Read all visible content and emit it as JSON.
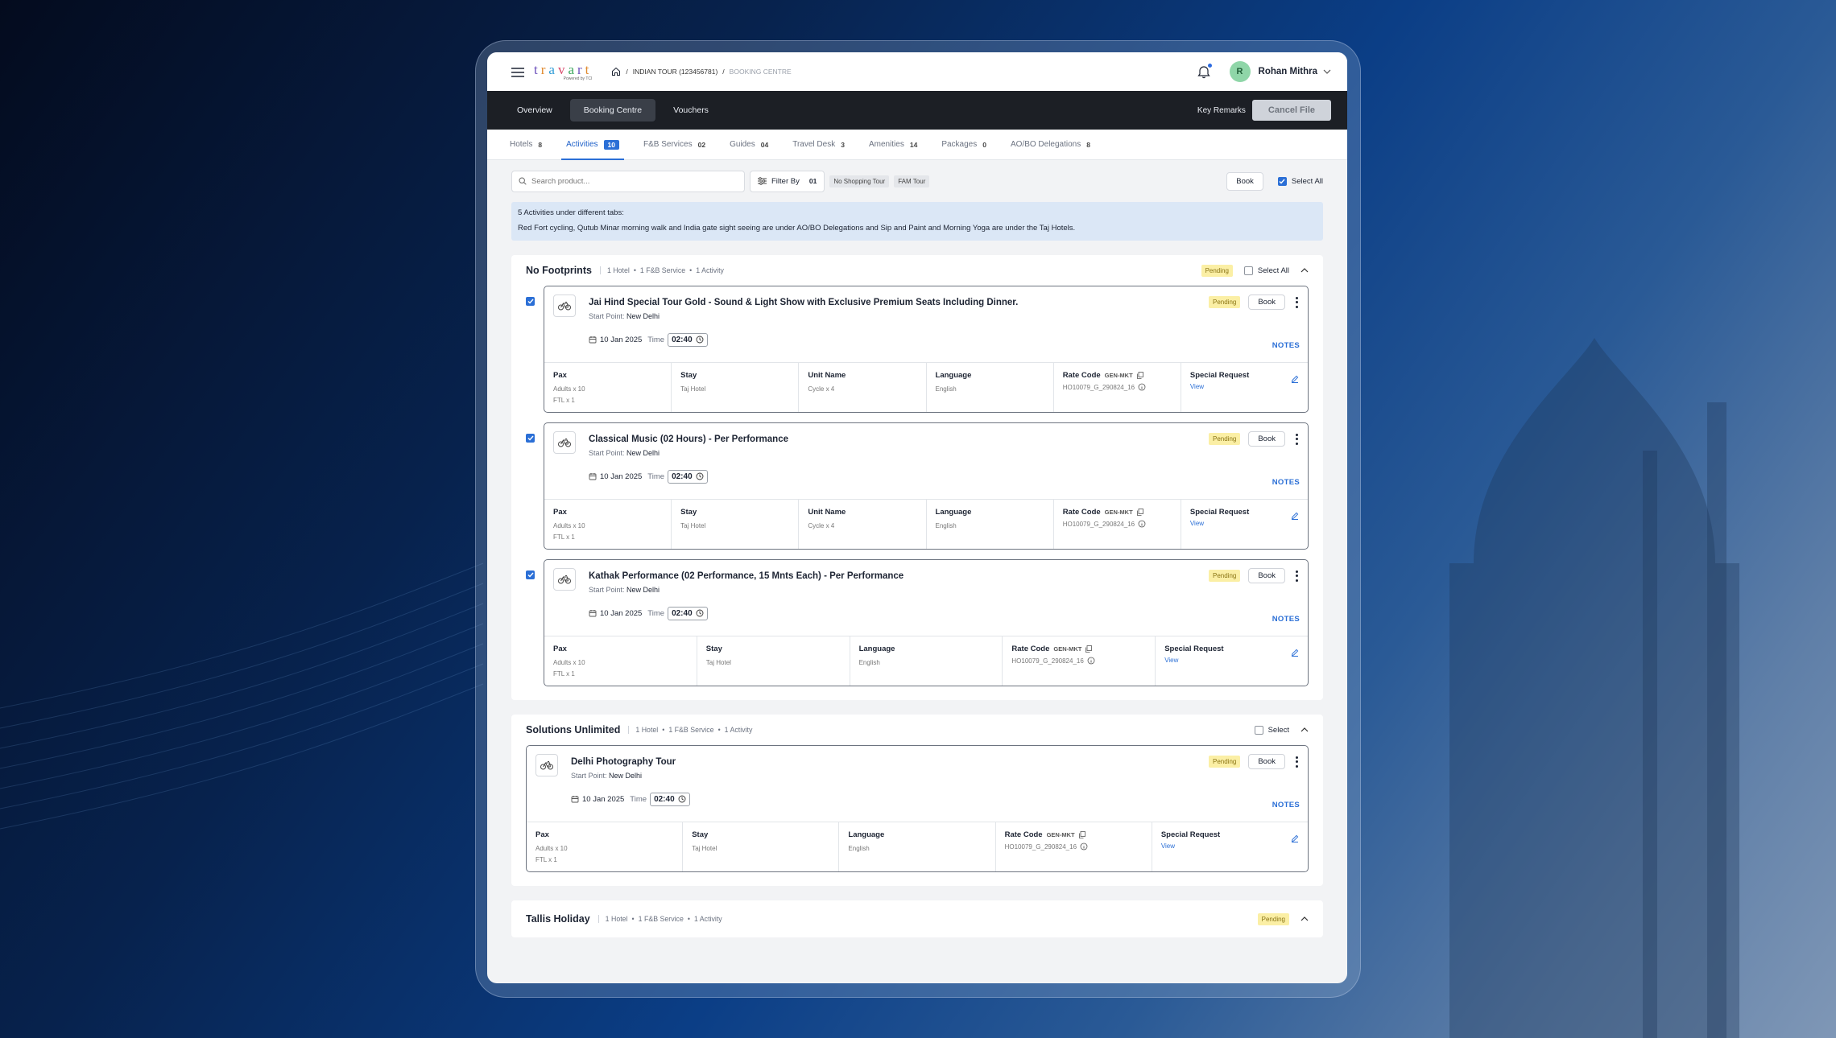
{
  "app": {
    "brand": "travart",
    "powered_by": "Powered by TCI"
  },
  "breadcrumb": {
    "tour": "INDIAN TOUR (123456781)",
    "current": "BOOKING CENTRE"
  },
  "user": {
    "initial": "R",
    "name": "Rohan Mithra"
  },
  "nav": {
    "tabs": [
      "Overview",
      "Booking Centre",
      "Vouchers"
    ],
    "active": "Booking Centre",
    "key_remarks": "Key Remarks",
    "cancel_file": "Cancel File"
  },
  "subtabs": [
    {
      "label": "Hotels",
      "count": "8"
    },
    {
      "label": "Activities",
      "count": "10"
    },
    {
      "label": "F&B Services",
      "count": "02"
    },
    {
      "label": "Guides",
      "count": "04"
    },
    {
      "label": "Travel Desk",
      "count": "3"
    },
    {
      "label": "Amenities",
      "count": "14"
    },
    {
      "label": "Packages",
      "count": "0"
    },
    {
      "label": "AO/BO Delegations",
      "count": "8"
    }
  ],
  "toolbar": {
    "search_placeholder": "Search product...",
    "filter_label": "Filter By",
    "filter_count": "01",
    "chips": [
      "No Shopping Tour",
      "FAM Tour"
    ],
    "book": "Book",
    "select_all": "Select All"
  },
  "info": {
    "title": "5 Activities under different tabs:",
    "body": "Red Fort cycling, Qutub Minar morning walk and India gate sight seeing are under AO/BO Delegations and Sip and Paint and Morning Yoga are under the Taj Hotels."
  },
  "labels": {
    "pending": "Pending",
    "book": "Book",
    "notes": "NOTES",
    "start_point": "Start Point:",
    "time": "Time",
    "pax": "Pax",
    "stay": "Stay",
    "unit_name": "Unit Name",
    "language": "Language",
    "rate_code": "Rate Code",
    "special_request": "Special Request",
    "view": "View"
  },
  "groups": [
    {
      "name": "No Footprints",
      "meta": [
        "1 Hotel",
        "1 F&B Service",
        "1 Activity"
      ],
      "status": "Pending",
      "select_label": "Select All",
      "cards": [
        {
          "title": "Jai Hind Special Tour Gold - Sound & Light Show with Exclusive Premium Seats Including Dinner.",
          "start": "New Delhi",
          "date": "10 Jan 2025",
          "time": "02:40",
          "status": "Pending",
          "pax": [
            "Adults x 10",
            "FTL x 1"
          ],
          "stay": "Taj Hotel",
          "unit": "Cycle x 4",
          "language": "English",
          "rate_tag": "GEN-MKT",
          "rate_code": "HO10079_G_290824_16"
        },
        {
          "title": "Classical Music (02 Hours) - Per Performance",
          "start": "New Delhi",
          "date": "10 Jan 2025",
          "time": "02:40",
          "status": "Pending",
          "pax": [
            "Adults x 10",
            "FTL x 1"
          ],
          "stay": "Taj Hotel",
          "unit": "Cycle x 4",
          "language": "English",
          "rate_tag": "GEN-MKT",
          "rate_code": "HO10079_G_290824_16"
        },
        {
          "title": "Kathak Performance (02 Performance, 15 Mnts Each) - Per Performance",
          "start": "New Delhi",
          "date": "10 Jan 2025",
          "time": "02:40",
          "status": "Pending",
          "pax": [
            "Adults x 10",
            "FTL x 1"
          ],
          "stay": "Taj Hotel",
          "language": "English",
          "rate_tag": "GEN-MKT",
          "rate_code": "HO10079_G_290824_16"
        }
      ]
    },
    {
      "name": "Solutions Unlimited",
      "meta": [
        "1 Hotel",
        "1 F&B Service",
        "1 Activity"
      ],
      "select_label": "Select",
      "cards": [
        {
          "title": "Delhi Photography Tour",
          "start": "New Delhi",
          "date": "10 Jan 2025",
          "time": "02:40",
          "status": "Pending",
          "pax": [
            "Adults x 10",
            "FTL x 1"
          ],
          "stay": "Taj Hotel",
          "language": "English",
          "rate_tag": "GEN-MKT",
          "rate_code": "HO10079_G_290824_16"
        }
      ]
    },
    {
      "name": "Tallis Holiday",
      "meta": [
        "1 Hotel",
        "1 F&B Service",
        "1 Activity"
      ],
      "status": "Pending"
    }
  ],
  "colors": {
    "accent": "#2b6fd6",
    "pending_bg": "#fbefa5",
    "nav_bg": "#1c1f25"
  }
}
